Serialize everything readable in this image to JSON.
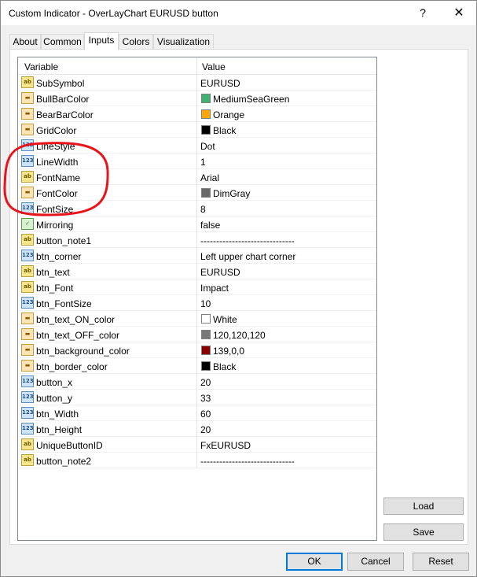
{
  "window": {
    "title": "Custom Indicator - OverLayChart EURUSD button",
    "help_glyph": "?",
    "close_glyph": "✕"
  },
  "tabs": [
    {
      "label": "About",
      "active": false
    },
    {
      "label": "Common",
      "active": false
    },
    {
      "label": "Inputs",
      "active": true
    },
    {
      "label": "Colors",
      "active": false
    },
    {
      "label": "Visualization",
      "active": false
    }
  ],
  "grid": {
    "header_variable": "Variable",
    "header_value": "Value",
    "rows": [
      {
        "icon": "ab",
        "name": "SubSymbol",
        "value": "EURUSD"
      },
      {
        "icon": "col",
        "name": "BullBarColor",
        "value": "MediumSeaGreen",
        "swatch": "#3cb371"
      },
      {
        "icon": "col",
        "name": "BearBarColor",
        "value": "Orange",
        "swatch": "#ffa500"
      },
      {
        "icon": "col",
        "name": "GridColor",
        "value": "Black",
        "swatch": "#000000"
      },
      {
        "icon": "num",
        "name": "LineStyle",
        "value": "Dot"
      },
      {
        "icon": "num",
        "name": "LineWidth",
        "value": "1"
      },
      {
        "icon": "ab",
        "name": "FontName",
        "value": "Arial"
      },
      {
        "icon": "col",
        "name": "FontColor",
        "value": "DimGray",
        "swatch": "#696969"
      },
      {
        "icon": "num",
        "name": "FontSize",
        "value": "8"
      },
      {
        "icon": "bool",
        "name": "Mirroring",
        "value": "false"
      },
      {
        "icon": "ab",
        "name": "button_note1",
        "value": "------------------------------"
      },
      {
        "icon": "num",
        "name": "btn_corner",
        "value": "Left upper chart corner"
      },
      {
        "icon": "ab",
        "name": "btn_text",
        "value": "EURUSD"
      },
      {
        "icon": "ab",
        "name": "btn_Font",
        "value": "Impact"
      },
      {
        "icon": "num",
        "name": "btn_FontSize",
        "value": "10"
      },
      {
        "icon": "col",
        "name": "btn_text_ON_color",
        "value": "White",
        "swatch": "#ffffff"
      },
      {
        "icon": "col",
        "name": "btn_text_OFF_color",
        "value": "120,120,120",
        "swatch": "#787878"
      },
      {
        "icon": "col",
        "name": "btn_background_color",
        "value": "139,0,0",
        "swatch": "#8b0000"
      },
      {
        "icon": "col",
        "name": "btn_border_color",
        "value": "Black",
        "swatch": "#000000"
      },
      {
        "icon": "num",
        "name": "button_x",
        "value": "20"
      },
      {
        "icon": "num",
        "name": "button_y",
        "value": "33"
      },
      {
        "icon": "num",
        "name": "btn_Width",
        "value": "60"
      },
      {
        "icon": "num",
        "name": "btn_Height",
        "value": "20"
      },
      {
        "icon": "ab",
        "name": "UniqueButtonID",
        "value": "FxEURUSD"
      },
      {
        "icon": "ab",
        "name": "button_note2",
        "value": "------------------------------"
      }
    ]
  },
  "icon_glyphs": {
    "ab": "ab",
    "num": "123",
    "col": "▬",
    "bool": "✓"
  },
  "buttons": {
    "load": "Load",
    "save": "Save",
    "ok": "OK",
    "cancel": "Cancel",
    "reset": "Reset"
  },
  "colors": {
    "annotation": "#e8141b",
    "default_button_border": "#0078d7"
  }
}
